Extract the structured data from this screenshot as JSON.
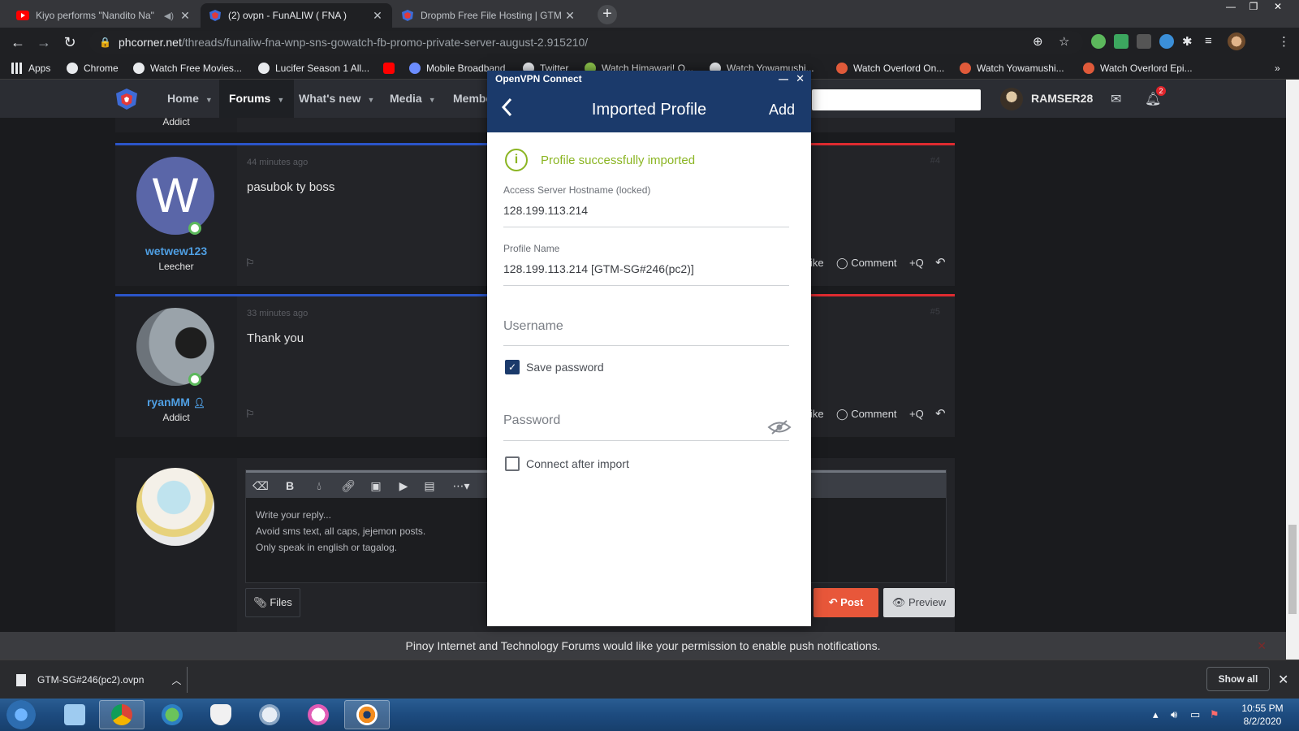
{
  "browser": {
    "tabs": [
      {
        "title": "Kiyo performs \"Nandito Na\"",
        "icon": "youtube-icon",
        "icon_color": "#ff0000"
      },
      {
        "title": "(2) ovpn - FunALIW ( FNA )",
        "icon": "phcorner-icon",
        "icon_color": "#3e6bd6"
      },
      {
        "title": "Dropmb Free File Hosting | GTM",
        "icon": "phcorner-icon",
        "icon_color": "#3e6bd6"
      }
    ],
    "new_tab_label": "+",
    "url_host": "phcorner.net",
    "url_path": "/threads/funaliw-fna-wnp-sns-gowatch-fb-promo-private-server-august-2.915210/"
  },
  "bookmarks": [
    {
      "label": "Apps",
      "icon": "apps-grid-icon",
      "color": "#e8eaed"
    },
    {
      "label": "Chrome",
      "icon": "chrome-icon",
      "color": "#e8eaed"
    },
    {
      "label": "Watch Free Movies...",
      "icon": "globe-icon",
      "color": "#e8eaed"
    },
    {
      "label": "Lucifer Season 1 All...",
      "icon": "globe-icon",
      "color": "#e8eaed"
    },
    {
      "label": "",
      "icon": "youtube-icon",
      "color": "#ff0000"
    },
    {
      "label": "Mobile Broadband",
      "icon": "globe-icon",
      "color": "#6b8cff"
    },
    {
      "label": "Twitter",
      "icon": "globe-icon",
      "color": "#e8eaed"
    },
    {
      "label": "Watch Himawari! O...",
      "icon": "leaf-icon",
      "color": "#8bc34a"
    },
    {
      "label": "Watch Yowamushi...",
      "icon": "globe-icon",
      "color": "#e8eaed"
    },
    {
      "label": "Watch Overlord On...",
      "icon": "leaf-icon",
      "color": "#e05a3a"
    },
    {
      "label": "Watch Yowamushi...",
      "icon": "leaf-icon",
      "color": "#e05a3a"
    },
    {
      "label": "Watch Overlord Epi...",
      "icon": "leaf-icon",
      "color": "#e05a3a"
    }
  ],
  "forum": {
    "nav": [
      {
        "label": "Home",
        "active": false
      },
      {
        "label": "Forums",
        "active": true
      },
      {
        "label": "What's new",
        "active": false
      },
      {
        "label": "Media",
        "active": false
      },
      {
        "label": "Membe",
        "active": false
      }
    ],
    "username": "RAMSER28",
    "notification_count": "2",
    "prev_role": "Addict",
    "posts": [
      {
        "time": "44 minutes ago",
        "message": "pasubok ty boss",
        "author": "wetwew123",
        "role": "Leecher",
        "avatar_letter": "W",
        "number": "#4"
      },
      {
        "time": "33 minutes ago",
        "message": "Thank you",
        "author": "ryanMM",
        "role": "Addict",
        "number": "#5"
      }
    ],
    "actions": {
      "like": "ike",
      "comment": "Comment",
      "quote": "+Q"
    },
    "reply": {
      "placeholder_lines": [
        "Write your reply...",
        "Avoid sms text, all caps, jejemon posts.",
        "Only speak in english or tagalog."
      ],
      "files_label": "Files",
      "post_label": "Post",
      "preview_label": "Preview"
    }
  },
  "push_notice": "Pinoy Internet and Technology Forums would like your permission to enable push notifications.",
  "download": {
    "file_name": "GTM-SG#246(pc2).ovpn",
    "show_all_label": "Show all"
  },
  "taskbar": {
    "time": "10:55 PM",
    "date": "8/2/2020"
  },
  "vpn": {
    "window_title": "OpenVPN Connect",
    "header_title": "Imported Profile",
    "add_label": "Add",
    "success_text": "Profile successfully imported",
    "hostname_label": "Access Server Hostname (locked)",
    "hostname_value": "128.199.113.214",
    "profile_label": "Profile Name",
    "profile_value": "128.199.113.214 [GTM-SG#246(pc2)]",
    "username_placeholder": "Username",
    "save_password_label": "Save password",
    "save_password_checked": true,
    "password_placeholder": "Password",
    "connect_after_label": "Connect after import",
    "connect_after_checked": false,
    "accent_color": "#1b3a6b",
    "success_color": "#8bb523"
  }
}
